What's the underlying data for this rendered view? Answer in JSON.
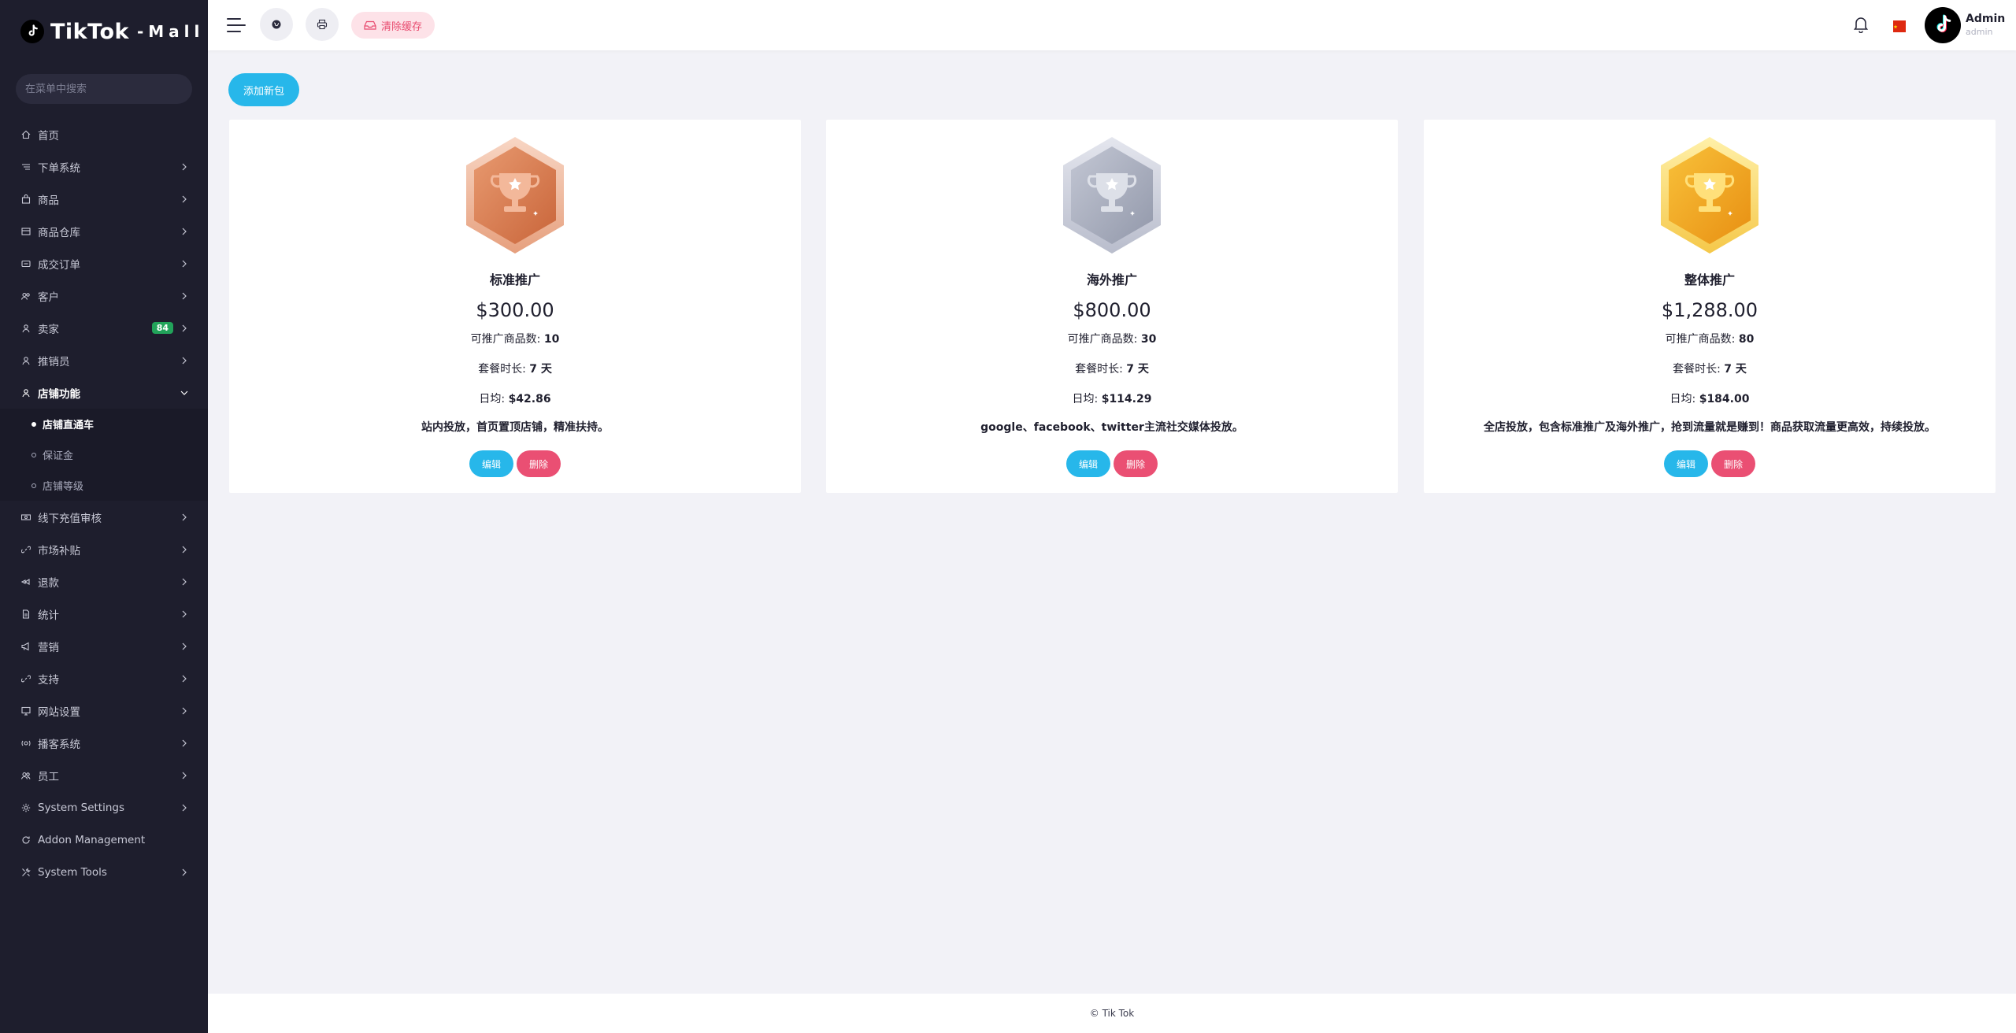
{
  "brand": {
    "main": "TikTok",
    "sub": "-Mall"
  },
  "sidebar": {
    "search_placeholder": "在菜单中搜索",
    "items": [
      {
        "label": "首页",
        "icon": "home-icon"
      },
      {
        "label": "下单系统",
        "icon": "list-icon"
      },
      {
        "label": "商品",
        "icon": "bag-icon"
      },
      {
        "label": "商品仓库",
        "icon": "warehouse-icon"
      },
      {
        "label": "成交订单",
        "icon": "order-icon"
      },
      {
        "label": "客户",
        "icon": "users-icon"
      },
      {
        "label": "卖家",
        "icon": "user-icon",
        "badge": "84"
      },
      {
        "label": "推销员",
        "icon": "user-icon"
      },
      {
        "label": "店铺功能",
        "icon": "user-icon"
      },
      {
        "label": "线下充值审核",
        "icon": "money-icon"
      },
      {
        "label": "市场补贴",
        "icon": "link-icon"
      },
      {
        "label": "退款",
        "icon": "refund-icon"
      },
      {
        "label": "统计",
        "icon": "file-icon"
      },
      {
        "label": "营销",
        "icon": "megaphone-icon"
      },
      {
        "label": "支持",
        "icon": "link-icon"
      },
      {
        "label": "网站设置",
        "icon": "monitor-icon"
      },
      {
        "label": "播客系统",
        "icon": "podcast-icon"
      },
      {
        "label": "员工",
        "icon": "staff-icon"
      },
      {
        "label": "System Settings",
        "icon": "gear-icon"
      },
      {
        "label": "Addon Management",
        "icon": "refresh-icon"
      },
      {
        "label": "System Tools",
        "icon": "tools-icon"
      }
    ],
    "store_submenu": [
      "店铺直通车",
      "保证金",
      "店铺等级"
    ]
  },
  "header": {
    "clear_cache": "清除缓存",
    "user_name": "Admin",
    "user_role": "admin"
  },
  "content": {
    "add_button": "添加新包",
    "cards": [
      {
        "name": "标准推广",
        "price": "$300.00",
        "products_label": "可推广商品数:",
        "products": "10",
        "duration_label": "套餐时长:",
        "duration": "7 天",
        "daily_label": "日均:",
        "daily": "$42.86",
        "desc": "站内投放，首页置顶店铺，精准扶持。",
        "medal": "bronze"
      },
      {
        "name": "海外推广",
        "price": "$800.00",
        "products_label": "可推广商品数:",
        "products": "30",
        "duration_label": "套餐时长:",
        "duration": "7 天",
        "daily_label": "日均:",
        "daily": "$114.29",
        "desc": "google、facebook、twitter主流社交媒体投放。",
        "medal": "silver"
      },
      {
        "name": "整体推广",
        "price": "$1,288.00",
        "products_label": "可推广商品数:",
        "products": "80",
        "duration_label": "套餐时长:",
        "duration": "7 天",
        "daily_label": "日均:",
        "daily": "$184.00",
        "desc": "全店投放，包含标准推广及海外推广，抢到流量就是赚到！商品获取流量更高效，持续投放。",
        "medal": "gold"
      }
    ],
    "edit_label": "编辑",
    "delete_label": "删除"
  },
  "footer": {
    "text": "© Tik Tok"
  },
  "colors": {
    "sidebar_bg": "#1e1e2d",
    "accent": "#27b7ea",
    "danger": "#ea4f73",
    "badge_green": "#22a35a"
  }
}
